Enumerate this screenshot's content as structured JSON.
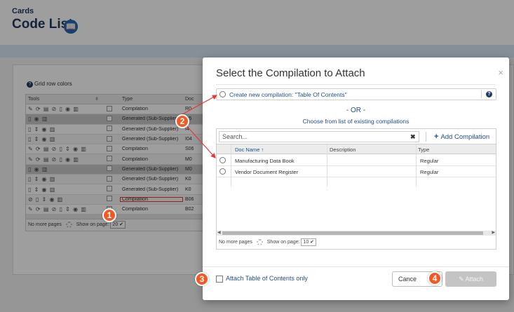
{
  "page": {
    "breadcrumb": "Cards",
    "title": "Code List",
    "title_icon": "book-icon",
    "grid_colors_label": "Grid row colors"
  },
  "grid": {
    "columns": {
      "tools": "Tools",
      "type": "Type",
      "doc": "Doc"
    },
    "rows": [
      {
        "tools": "✎ ⟳ ▤ ⊘ ▯ ◉ ▥",
        "type": "Compilation",
        "doc": "R0"
      },
      {
        "tools": "▯ ◉ ▥",
        "type": "Generated (Sub-Supplier)",
        "doc": "O5"
      },
      {
        "tools": "▯ ⇕ ◉ ▥",
        "type": "Generated (Sub-Supplier)",
        "doc": "I4"
      },
      {
        "tools": "▯ ⇕ ◉ ▥",
        "type": "Generated (Sub-Supplier)",
        "doc": "I04"
      },
      {
        "tools": "✎ ⟳ ▤ ⊘ ▯ ⇕ ◉ ▥",
        "type": "Compilation",
        "doc": "S06"
      },
      {
        "tools": "✎ ⟳ ▤ ⊘ ▯ ◉ ▥",
        "type": "Compilation",
        "doc": "M0"
      },
      {
        "tools": "▯ ◉ ▥",
        "type": "Generated (Sub-Supplier)",
        "doc": "M0"
      },
      {
        "tools": "▯ ⇕ ◉ ▥",
        "type": "Generated (Sub-Supplier)",
        "doc": "K0"
      },
      {
        "tools": "▯ ⇕ ◉ ▥",
        "type": "Generated (Sub-Supplier)",
        "doc": "K0"
      },
      {
        "tools": "⊘ ▯ ⇕ ◉ ▥",
        "type": "Compilation",
        "doc": "B06"
      },
      {
        "tools": "✎ ⟳ ▤ ⊘ ▯ ⇕ ◉ ▥",
        "type": "Compilation",
        "doc": "B02"
      }
    ],
    "footer": {
      "no_more": "No more pages",
      "show_on_page": "Show on page:",
      "page_size": "20 ✔"
    }
  },
  "modal": {
    "title": "Select the Compilation to Attach",
    "close_glyph": "×",
    "create_label": "Create new compilation: \"Table Of Contents\"",
    "help_glyph": "?",
    "or_text": "- OR -",
    "choose_text": "Choose from list of existing compilations",
    "search_placeholder": "Search...",
    "search_clear": "✖",
    "add_label": "Add Compilation",
    "add_glyph": "+",
    "columns": {
      "doc_name": "Doc Name ↑",
      "description": "Description",
      "type": "Type"
    },
    "rows": [
      {
        "doc_name": "Manufacturing Data Book",
        "description": "",
        "type": "Regular"
      },
      {
        "doc_name": "Vendor Document Register",
        "description": "",
        "type": "Regular"
      }
    ],
    "footer": {
      "no_more": "No more pages",
      "show_on_page": "Show on page:",
      "page_size": "10 ✔"
    },
    "attach_toc_label": "Attach Table of Contents only",
    "cancel_label": "Cance",
    "attach_label": "✎ Attach"
  },
  "callouts": [
    "1",
    "2",
    "3",
    "4"
  ],
  "colors": {
    "accent": "#1f4e8c",
    "callout": "#f15a24",
    "title": "#233a5e"
  }
}
